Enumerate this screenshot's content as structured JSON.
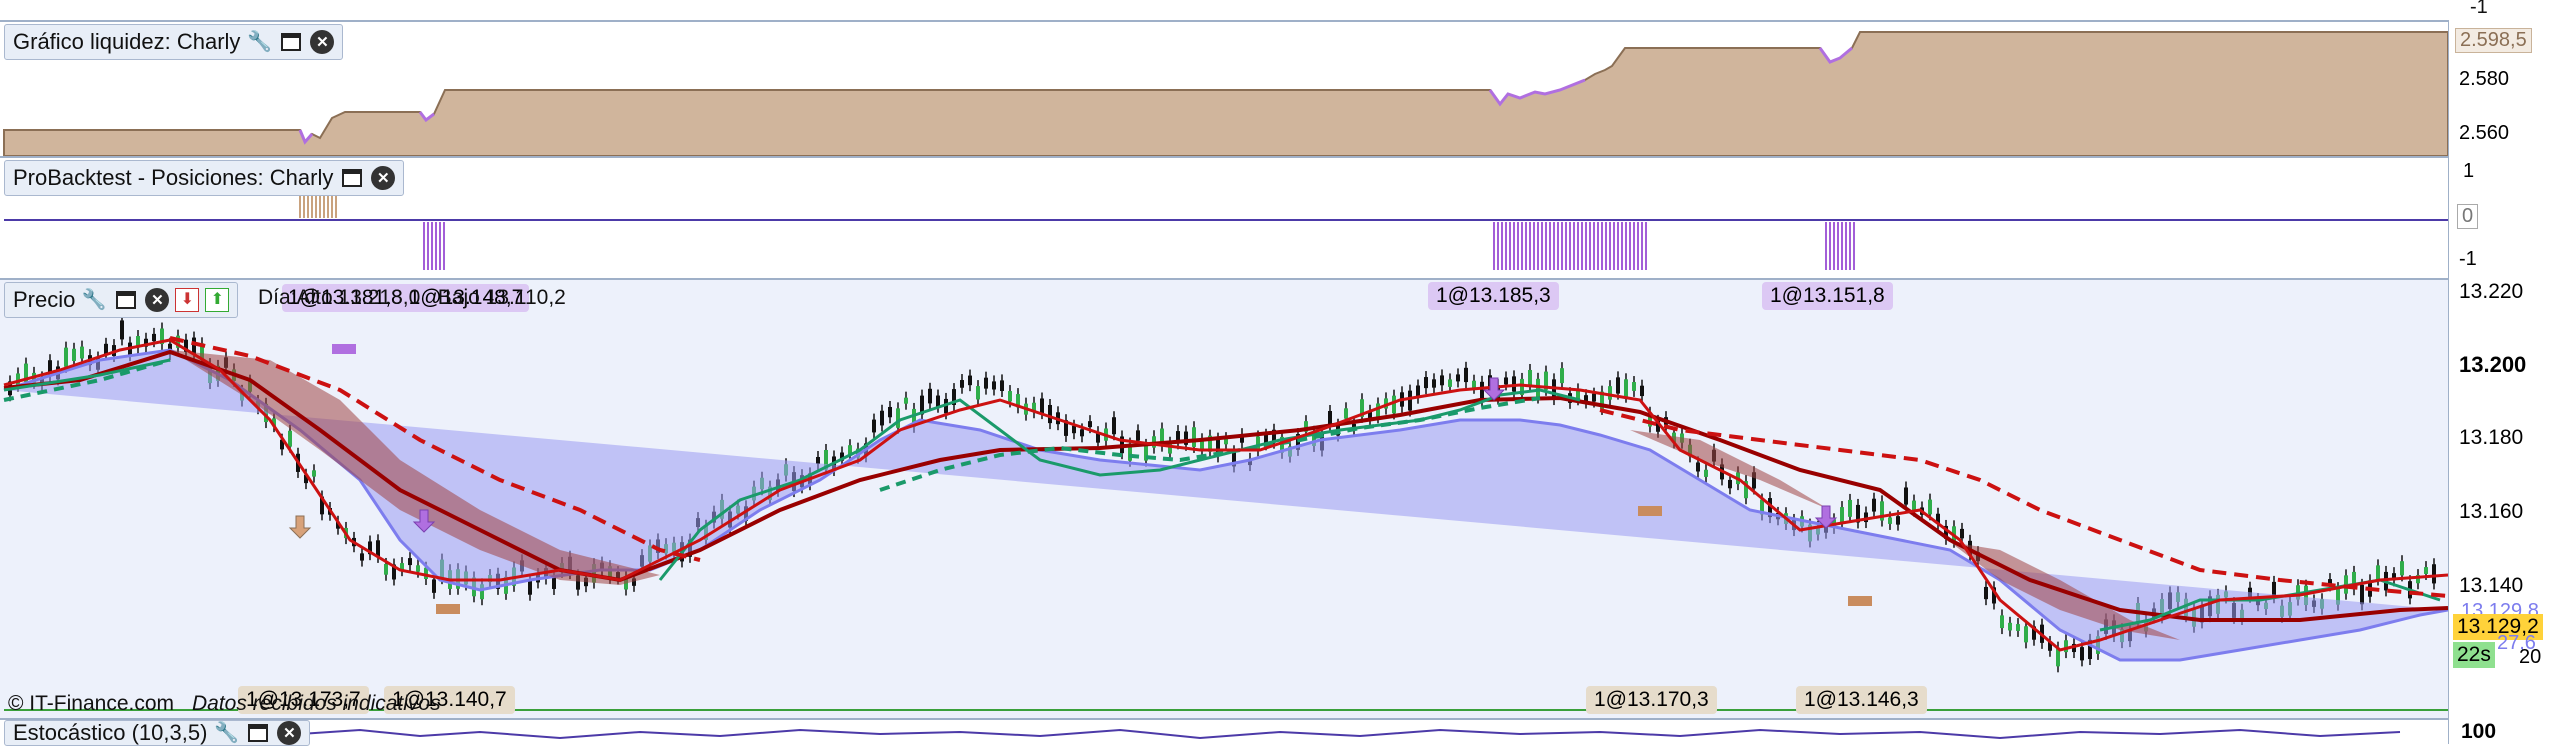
{
  "liquidity_panel": {
    "title": "Gráfico liquidez: Charly",
    "axis_labels": [
      "2.580",
      "2.560"
    ],
    "current_value": "2.598,5",
    "top_axis_label": "-1",
    "colors": {
      "fill": "#d0b59c",
      "line": "#8b6f55",
      "drawdown": "#b06fe0"
    }
  },
  "positions_panel": {
    "title": "ProBacktest - Posiciones: Charly",
    "axis_labels": [
      "1",
      "-1"
    ],
    "zero_label": "0",
    "colors": {
      "bars": "#a35fd8",
      "line": "#4c3aa8"
    }
  },
  "price_panel": {
    "title": "Precio",
    "info_text": "Día:Alto 13.213,0   Bajo 13.110,2",
    "overlap_text": "1@13.181,8  1@13.148,7",
    "trade_tags_top": [
      "1@13.185,3",
      "1@13.151,8"
    ],
    "trade_tags_bottom": [
      "1@13.173,7",
      "1@13.140,7",
      "1@13.170,3",
      "1@13.146,3"
    ],
    "axis_labels": [
      "13.220",
      "13.200",
      "13.180",
      "13.160",
      "13.140",
      "20"
    ],
    "current_price": "13.129,2",
    "secondary_price": "13.129,8",
    "indicator_value": "27,6",
    "timer": "22s",
    "footer_copyright": "© IT-Finance.com",
    "footer_note": "Datos recibidos indicativos",
    "colors": {
      "background": "#edf1fb",
      "fast_ma": "#cc1111",
      "slow_ma": "#990000",
      "green_ma": "#1a9a6a",
      "blue_band": "#7d7dee",
      "red_fill": "#a04545",
      "price_label_bg": "#ffd23a",
      "timer_bg": "#8fe08f"
    }
  },
  "stochastic_panel": {
    "title": "Estocástico (10,3,5)",
    "axis_label": "100"
  },
  "icons": [
    "wrench-icon",
    "window-icon",
    "close-icon",
    "arrow-down-icon",
    "arrow-up-icon"
  ]
}
